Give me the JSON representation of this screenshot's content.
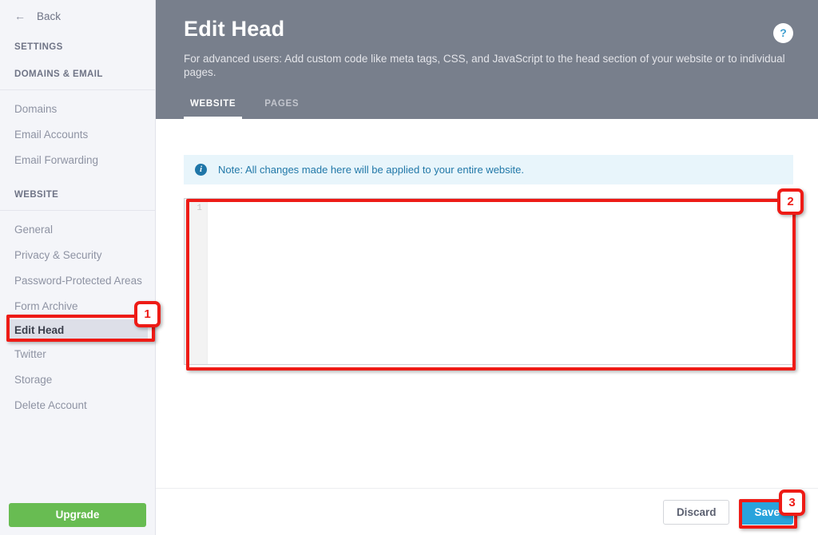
{
  "sidebar": {
    "back": {
      "icon": "arrow-left-icon",
      "label": "Back"
    },
    "settings_heading": "SETTINGS",
    "sections": [
      {
        "heading": "DOMAINS & EMAIL",
        "items": [
          {
            "label": "Domains",
            "active": false
          },
          {
            "label": "Email Accounts",
            "active": false
          },
          {
            "label": "Email Forwarding",
            "active": false
          }
        ]
      },
      {
        "heading": "WEBSITE",
        "items": [
          {
            "label": "General",
            "active": false
          },
          {
            "label": "Privacy & Security",
            "active": false
          },
          {
            "label": "Password-Protected Areas",
            "active": false
          },
          {
            "label": "Form Archive",
            "active": false
          },
          {
            "label": "Edit Head",
            "active": true
          },
          {
            "label": "Twitter",
            "active": false
          },
          {
            "label": "Storage",
            "active": false
          },
          {
            "label": "Delete Account",
            "active": false
          }
        ]
      }
    ],
    "upgrade_label": "Upgrade",
    "upgrade_color": "#68bc52",
    "background_color": "#f4f5f9"
  },
  "header": {
    "title": "Edit Head",
    "subtitle": "For advanced users: Add custom code like meta tags, CSS, and JavaScript to the head section of your website or to individual pages.",
    "background_color": "#787f8c",
    "help_label": "?",
    "tabs": [
      {
        "label": "WEBSITE",
        "active": true
      },
      {
        "label": "PAGES",
        "active": false
      }
    ]
  },
  "content": {
    "note": {
      "icon": "info-icon",
      "text": "Note: All changes made here will be applied to your entire website.",
      "background_color": "#e8f5fb",
      "text_color": "#2178a8"
    },
    "editor": {
      "line_numbers": [
        "1"
      ],
      "value": "",
      "placeholder": ""
    }
  },
  "footer": {
    "discard_label": "Discard",
    "save_label": "Save",
    "save_color": "#29a3dc"
  },
  "annotations": [
    {
      "number": "1",
      "target": "Edit Head sidebar item"
    },
    {
      "number": "2",
      "target": "code editor"
    },
    {
      "number": "3",
      "target": "Save button"
    }
  ]
}
